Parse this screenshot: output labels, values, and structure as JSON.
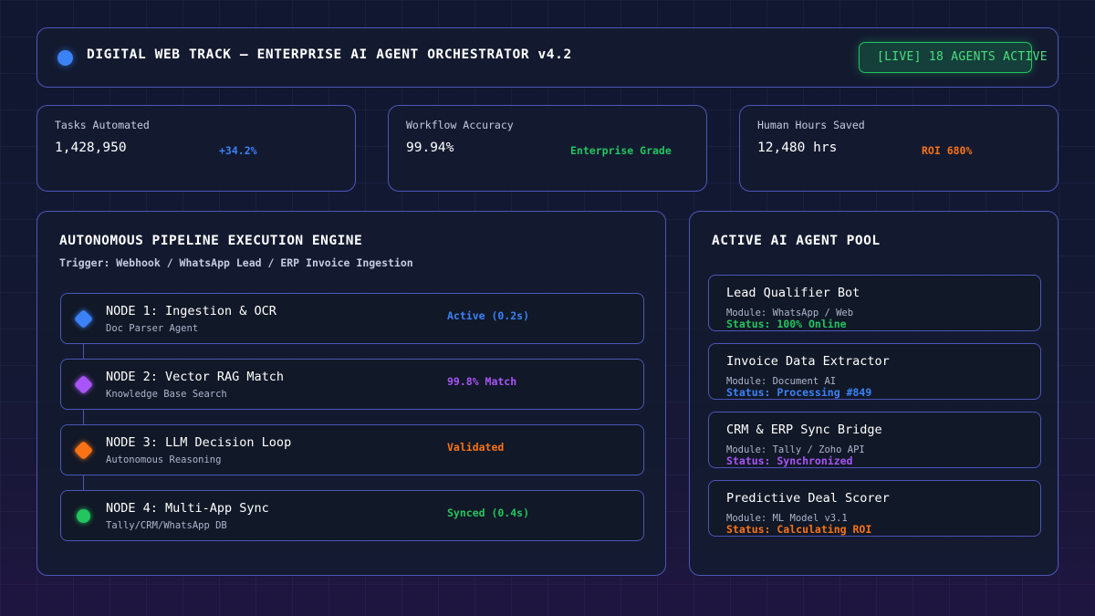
{
  "header": {
    "title": "DIGITAL WEB TRACK – ENTERPRISE AI AGENT ORCHESTRATOR v4.2",
    "live_badge": "[LIVE] 18 AGENTS ACTIVE"
  },
  "metrics": [
    {
      "label": "Tasks Automated",
      "value": "1,428,950",
      "note": "+34.2%",
      "note_color": "#3b82f6"
    },
    {
      "label": "Workflow Accuracy",
      "value": "99.94%",
      "note": "Enterprise Grade",
      "note_color": "#22c55e"
    },
    {
      "label": "Human Hours Saved",
      "value": "12,480 hrs",
      "note": "ROI 680%",
      "note_color": "#f97316"
    }
  ],
  "pipeline": {
    "title": "AUTONOMOUS PIPELINE EXECUTION ENGINE",
    "trigger": "Trigger: Webhook / WhatsApp Lead / ERP Invoice Ingestion",
    "nodes": [
      {
        "name": "NODE 1: Ingestion & OCR",
        "desc": "Doc Parser Agent",
        "state": "Active (0.2s)",
        "color": "#3b82f6",
        "marker": "diamond"
      },
      {
        "name": "NODE 2: Vector RAG Match",
        "desc": "Knowledge Base Search",
        "state": "99.8% Match",
        "color": "#a855f7",
        "marker": "diamond"
      },
      {
        "name": "NODE 3: LLM Decision Loop",
        "desc": "Autonomous Reasoning",
        "state": "Validated",
        "color": "#f97316",
        "marker": "diamond"
      },
      {
        "name": "NODE 4: Multi-App Sync",
        "desc": "Tally/CRM/WhatsApp DB",
        "state": "Synced (0.4s)",
        "color": "#22c55e",
        "marker": "circle"
      }
    ]
  },
  "agents": {
    "title": "ACTIVE AI AGENT POOL",
    "items": [
      {
        "name": "Lead Qualifier Bot",
        "module": "Module: WhatsApp / Web",
        "status": "Status: 100% Online",
        "color": "#22c55e"
      },
      {
        "name": "Invoice Data Extractor",
        "module": "Module: Document AI",
        "status": "Status: Processing #849",
        "color": "#3b82f6"
      },
      {
        "name": "CRM & ERP Sync Bridge",
        "module": "Module: Tally / Zoho API",
        "status": "Status: Synchronized",
        "color": "#a855f7"
      },
      {
        "name": "Predictive Deal Scorer",
        "module": "Module: ML Model v3.1",
        "status": "Status: Calculating ROI",
        "color": "#f97316"
      }
    ]
  }
}
